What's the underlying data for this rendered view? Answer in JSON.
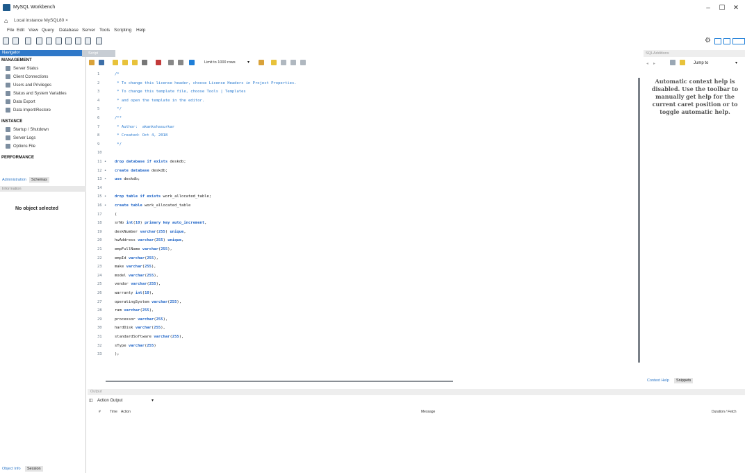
{
  "window": {
    "title": "MySQL Workbench",
    "minimize": "–",
    "maximize": "☐",
    "close": "✕"
  },
  "tabs": {
    "home_icon": "home-icon",
    "connection_tab": "Local instance MySQL80  ×"
  },
  "menubar": [
    "File",
    "Edit",
    "View",
    "Query",
    "Database",
    "Server",
    "Tools",
    "Scripting",
    "Help"
  ],
  "navigator": {
    "header": "Navigator",
    "management": {
      "title": "MANAGEMENT",
      "items": [
        "Server Status",
        "Client Connections",
        "Users and Privileges",
        "Status and System Variables",
        "Data Export",
        "Data Import/Restore"
      ]
    },
    "instance": {
      "title": "INSTANCE",
      "items": [
        "Startup / Shutdown",
        "Server Logs",
        "Options File"
      ]
    },
    "performance": {
      "title": "PERFORMANCE"
    },
    "subtabs": [
      "Administration",
      "Schemas"
    ],
    "info_header": "Information",
    "no_object": "No object selected",
    "bottom_tabs": [
      "Object Info",
      "Session"
    ]
  },
  "editor": {
    "tab_label": "Script",
    "limit_label": "Limit to 1000 rows",
    "lines": [
      {
        "n": "1",
        "t": "/*",
        "c": "cm"
      },
      {
        "n": "2",
        "t": " * To change this license header, choose License Headers in Project Properties.",
        "c": "cm"
      },
      {
        "n": "3",
        "t": " * To change this template file, choose Tools | Templates",
        "c": "cm"
      },
      {
        "n": "4",
        "t": " * and open the template in the editor.",
        "c": "cm"
      },
      {
        "n": "5",
        "t": " */",
        "c": "cm"
      },
      {
        "n": "6",
        "t": "/**",
        "c": "cm"
      },
      {
        "n": "7",
        "t": " * Author:  akankshasurkar",
        "c": "cm"
      },
      {
        "n": "8",
        "t": " * Created: Oct 4, 2018",
        "c": "cm"
      },
      {
        "n": "9",
        "t": " */",
        "c": "cm"
      },
      {
        "n": "10",
        "t": "",
        "c": ""
      },
      {
        "n": "11 •",
        "t": "drop database if exists deskdb;",
        "c": ""
      },
      {
        "n": "12 •",
        "t": "create database deskdb;",
        "c": ""
      },
      {
        "n": "13 •",
        "t": "use deskdb;",
        "c": ""
      },
      {
        "n": "14",
        "t": "",
        "c": ""
      },
      {
        "n": "15 •",
        "t": "drop table if exists work_allocated_table;",
        "c": ""
      },
      {
        "n": "16 •",
        "t": "create table work_allocated_table",
        "c": ""
      },
      {
        "n": "17",
        "t": "(",
        "c": ""
      },
      {
        "n": "18",
        "t": "srNo int(10) primary key auto_increment,",
        "c": ""
      },
      {
        "n": "19",
        "t": "deskNumber varchar(255) unique,",
        "c": ""
      },
      {
        "n": "20",
        "t": "hwAddress varchar(255) unique,",
        "c": ""
      },
      {
        "n": "21",
        "t": "empFullName varchar(255),",
        "c": ""
      },
      {
        "n": "22",
        "t": "empId varchar(255),",
        "c": ""
      },
      {
        "n": "23",
        "t": "make varchar(255),",
        "c": ""
      },
      {
        "n": "24",
        "t": "model varchar(255),",
        "c": ""
      },
      {
        "n": "25",
        "t": "vendor varchar(255),",
        "c": ""
      },
      {
        "n": "26",
        "t": "warranty int(10),",
        "c": ""
      },
      {
        "n": "27",
        "t": "operatingSystem varchar(255),",
        "c": ""
      },
      {
        "n": "28",
        "t": "ram varchar(255),",
        "c": ""
      },
      {
        "n": "29",
        "t": "processor varchar(255),",
        "c": ""
      },
      {
        "n": "30",
        "t": "hardDisk varchar(255),",
        "c": ""
      },
      {
        "n": "31",
        "t": "standardSoftware varchar(255),",
        "c": ""
      },
      {
        "n": "32",
        "t": "sType varchar(255)",
        "c": ""
      },
      {
        "n": "33",
        "t": ");",
        "c": ""
      }
    ]
  },
  "sqladditions": {
    "header": "SQLAdditions",
    "jump_to": "Jump to",
    "help_text": "Automatic context help is disabled. Use the toolbar to manually get help for the current caret position or to toggle automatic help.",
    "tabs": [
      "Context Help",
      "Snippets"
    ]
  },
  "output": {
    "header": "Output",
    "selector": "Action Output",
    "columns": {
      "num": "#",
      "time": "Time",
      "action": "Action",
      "message": "Message",
      "duration": "Duration / Fetch"
    }
  }
}
